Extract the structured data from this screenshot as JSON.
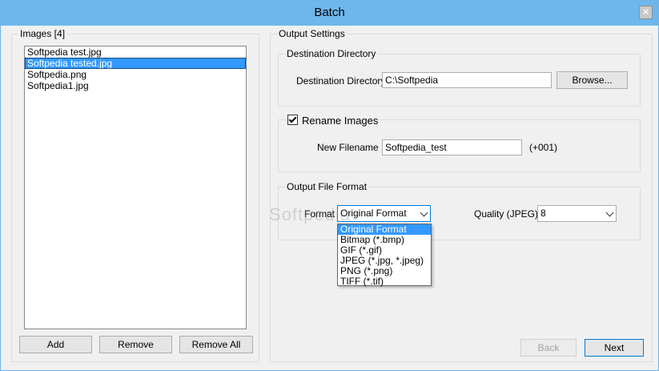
{
  "window": {
    "title": "Batch"
  },
  "images_panel": {
    "legend": "Images [4]",
    "items": [
      {
        "name": "Softpedia test.jpg",
        "selected": false
      },
      {
        "name": "Softpedia tested.jpg",
        "selected": true
      },
      {
        "name": "Softpedia.png",
        "selected": false
      },
      {
        "name": "Softpedia1.jpg",
        "selected": false
      }
    ],
    "add_label": "Add",
    "remove_label": "Remove",
    "remove_all_label": "Remove All"
  },
  "output_settings": {
    "legend": "Output Settings",
    "destination": {
      "legend": "Destination Directory",
      "label": "Destination Directory",
      "value": "C:\\Softpedia",
      "browse_label": "Browse..."
    },
    "rename": {
      "legend": "Rename Images",
      "checked": true,
      "new_filename_label": "New Filename",
      "new_filename_value": "Softpedia_test",
      "suffix": "(+001)"
    },
    "format": {
      "legend": "Output File Format",
      "format_label": "Format",
      "selected": "Original Format",
      "options": [
        "Original Format",
        "Bitmap (*.bmp)",
        "GIF (*.gif)",
        "JPEG (*.jpg, *.jpeg)",
        "PNG (*.png)",
        "TIFF (*.tif)"
      ],
      "quality_label": "Quality (JPEG)",
      "quality_value": "8"
    }
  },
  "footer": {
    "back_label": "Back",
    "next_label": "Next"
  },
  "watermark": "Softpedia",
  "colors": {
    "titlebar": "#6db7ec",
    "selection": "#3399ff",
    "window_bg": "#f0f0f0"
  }
}
